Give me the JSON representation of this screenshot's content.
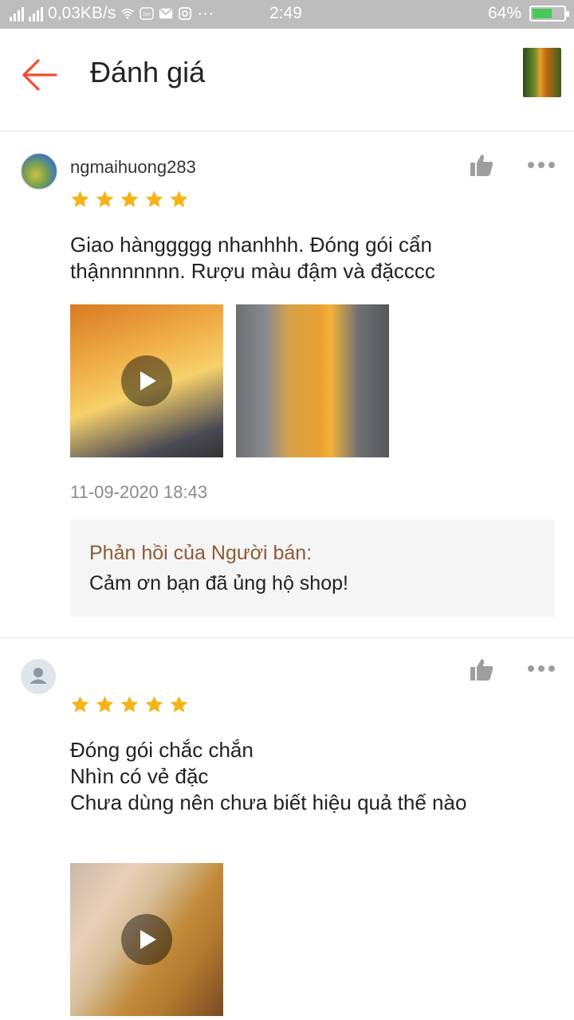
{
  "status_bar": {
    "speed": "0,03KB/s",
    "time": "2:49",
    "battery": "64%",
    "battery_level": 0.64,
    "notification_icons": [
      "wifi-icon",
      "zalo-icon",
      "gmail-icon",
      "instagram-icon",
      "more-dots-icon"
    ]
  },
  "header": {
    "title": "Đánh giá",
    "back_icon": "arrow-left-icon",
    "accent_color": "#ee4d2d"
  },
  "reviews": [
    {
      "username": "ngmaihuong283",
      "rating": 5,
      "comment": "Giao hànggggg nhanhhh. Đóng gói cẩn\nthậnnnnnnn. Rượu màu đậm và đặcccc",
      "media": [
        {
          "type": "video",
          "desc_icon": "play-icon"
        },
        {
          "type": "image"
        }
      ],
      "date": "11-09-2020 18:43",
      "seller_reply": {
        "title": "Phản hồi của Người bán:",
        "text": "Cảm ơn bạn đã ủng hộ shop!"
      }
    },
    {
      "username": "",
      "rating": 5,
      "comment": "Đóng gói chắc chắn\nNhìn có vẻ đặc\nChưa dùng nên chưa biết hiệu quả thế nào",
      "media": [
        {
          "type": "video",
          "desc_icon": "play-icon"
        }
      ]
    }
  ],
  "colors": {
    "star": "#f5b318",
    "reply_title": "#8d5a35",
    "statusbar_bg": "#bdbdbd"
  }
}
